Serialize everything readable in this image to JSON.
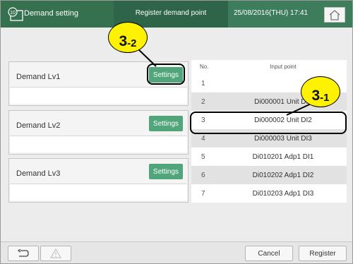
{
  "header": {
    "title": "Demand setting",
    "subtitle": "Register demand point",
    "datetime": "25/08/2016(THU) 17:41",
    "home_icon": "home-icon",
    "screen_icon": "screen-10-icon",
    "screen_icon_text": "10"
  },
  "demand_levels": [
    {
      "label": "Demand Lv1",
      "button": "Settings",
      "value": ""
    },
    {
      "label": "Demand Lv2",
      "button": "Settings",
      "value": ""
    },
    {
      "label": "Demand Lv3",
      "button": "Settings",
      "value": ""
    }
  ],
  "input_list": {
    "columns": {
      "no": "No.",
      "input_point": "Input point"
    },
    "rows": [
      {
        "no": "1",
        "point": ""
      },
      {
        "no": "2",
        "point": "Di000001 Unit DI1"
      },
      {
        "no": "3",
        "point": "Di000002 Unit DI2"
      },
      {
        "no": "4",
        "point": "Di000003 Unit DI3"
      },
      {
        "no": "5",
        "point": "Di010201 Adp1 DI1"
      },
      {
        "no": "6",
        "point": "Di010202 Adp1 DI2"
      },
      {
        "no": "7",
        "point": "Di010203 Adp1 DI3"
      }
    ]
  },
  "footer": {
    "back_icon": "return-arrow-icon",
    "warning_icon": "warning-icon",
    "cancel": "Cancel",
    "register": "Register"
  },
  "annotations": {
    "callout_1": {
      "main": "3",
      "sub": "-1"
    },
    "callout_2": {
      "main": "3",
      "sub": "-2"
    }
  }
}
